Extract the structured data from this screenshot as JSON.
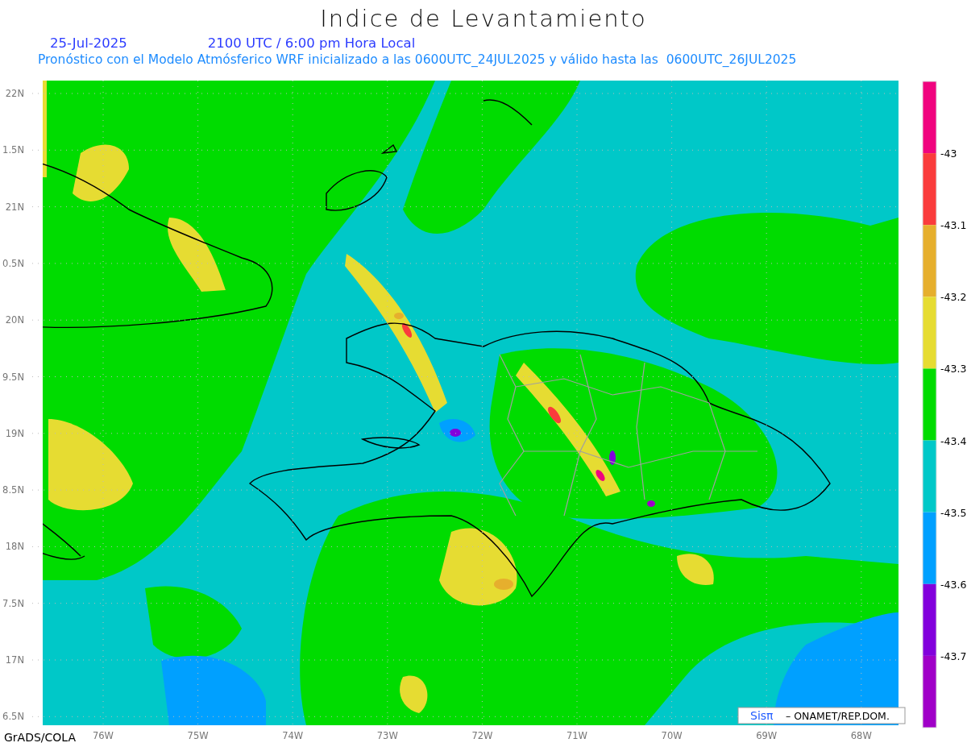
{
  "title": "Indice de Levantamiento",
  "date": "25-Jul-2025",
  "time": "2100 UTC / 6:00 pm Hora Local",
  "subtitle": "Pronóstico con el Modelo Atmósferico WRF inicializado a las 0600UTC_24JUL2025 y válido hasta las  0600UTC_26JUL2025",
  "map": {
    "lat_labels": [
      "22N",
      "1.5N",
      "21N",
      "0.5N",
      "20N",
      "9.5N",
      "19N",
      "8.5N",
      "18N",
      "7.5N",
      "17N",
      "6.5N"
    ],
    "lon_labels": [
      "76W",
      "75W",
      "74W",
      "73W",
      "72W",
      "71W",
      "70W",
      "69W",
      "68W"
    ]
  },
  "colorbar": {
    "colors": [
      {
        "color": "#f0047f"
      },
      {
        "color": "#fa3c3c"
      },
      {
        "color": "#e6af2d"
      },
      {
        "color": "#e6dc32"
      },
      {
        "color": "#00dc00"
      },
      {
        "color": "#00c8c8"
      },
      {
        "color": "#00a0ff"
      },
      {
        "color": "#8200dc"
      },
      {
        "color": "#a000c8"
      }
    ],
    "labels": [
      "-43",
      "-43.1",
      "-43.2",
      "-43.3",
      "-43.4",
      "-43.5",
      "-43.6",
      "-43.7"
    ]
  },
  "credit": {
    "logo": "Sisπ",
    "text": "– ONAMET/REP.DOM."
  },
  "footer": "GrADS/COLA"
}
